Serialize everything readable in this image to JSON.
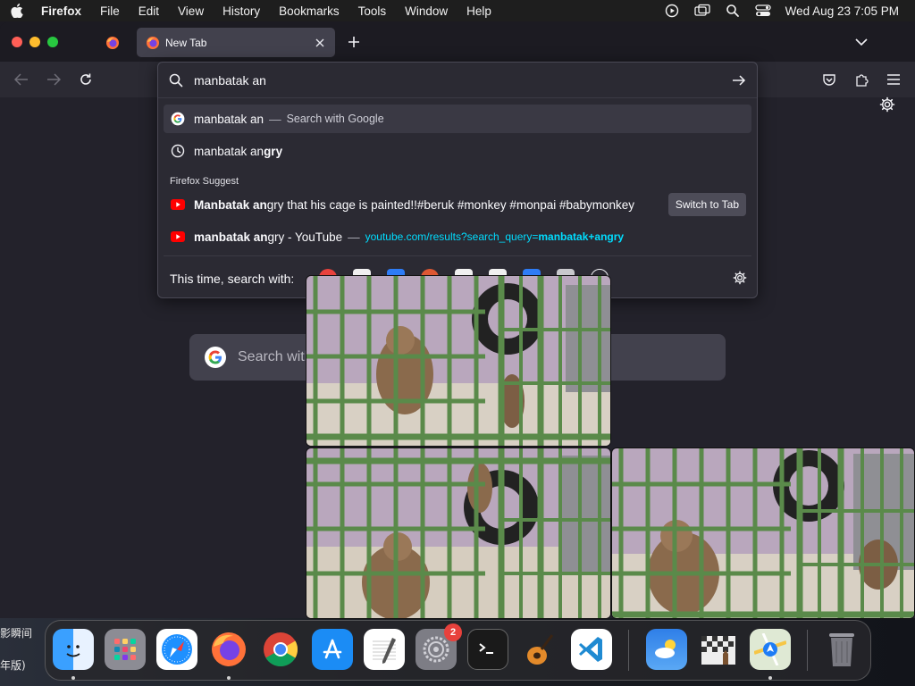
{
  "menubar": {
    "app_name": "Firefox",
    "menus": [
      "File",
      "Edit",
      "View",
      "History",
      "Bookmarks",
      "Tools",
      "Window",
      "Help"
    ],
    "clock": "Wed Aug 23  7:05 PM"
  },
  "tabs": {
    "active_title": "New Tab"
  },
  "urlbar": {
    "value": "manbatak an",
    "results": [
      {
        "typed": "manbatak an",
        "rest": "",
        "sep": "—",
        "action": "Search with Google"
      },
      {
        "typed": "manbatak an",
        "rest": "gry"
      }
    ],
    "suggest_label": "Firefox Suggest",
    "suggest": [
      {
        "typed": "Manbatak an",
        "rest": "gry that his cage is painted!!#beruk #monkey #monpai #babymonkey",
        "button": "Switch to Tab"
      },
      {
        "typed": "manbatak an",
        "rest": "gry - YouTube",
        "sep": "—",
        "url_prefix": "youtube.com/results?search_query=",
        "url_bold": "manbatak+angry"
      }
    ],
    "search_with_label": "This time, search with:"
  },
  "newtab": {
    "search_placeholder": "Search with"
  },
  "desktop": {
    "wall_text_1": "影瞬间",
    "wall_text_2": "年版)"
  },
  "dock": {
    "items": [
      "Finder",
      "Launchpad",
      "Safari",
      "Firefox",
      "Chrome",
      "App Store",
      "TextEdit",
      "System Settings",
      "Terminal",
      "GarageBand",
      "Visual Studio Code",
      "Weather",
      "Chess",
      "Maps",
      "Trash"
    ],
    "settings_badge": "2"
  },
  "colors": {
    "accent": "#00ddff",
    "panel": "#2b2a33",
    "window_bg": "#1c1b22"
  }
}
